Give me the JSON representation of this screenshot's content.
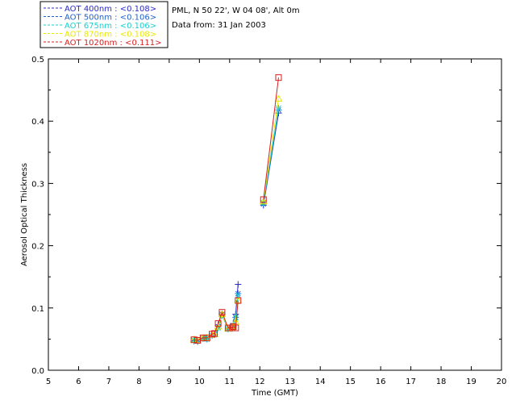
{
  "chart_data": {
    "type": "line",
    "xlabel": "Time (GMT)",
    "ylabel": "Aerosol Optical Thickness",
    "xlim": [
      5,
      20
    ],
    "ylim": [
      0.0,
      0.5
    ],
    "xticks": [
      "5",
      "6",
      "7",
      "8",
      "9",
      "10",
      "11",
      "12",
      "13",
      "14",
      "15",
      "16",
      "17",
      "18",
      "19",
      "20"
    ],
    "yticks": [
      "0.0",
      "0.1",
      "0.2",
      "0.3",
      "0.4",
      "0.5"
    ],
    "info": [
      "PML, N 50 22', W 04 08', Alt 0m",
      "Data from: 31 Jan 2003"
    ],
    "series": [
      {
        "name": "AOT 400nm",
        "mean_label": ": <0.108>",
        "color": "#2a2acb",
        "marker": "plus",
        "x": [
          9.82,
          9.94,
          10.12,
          10.25,
          10.42,
          10.5,
          10.62,
          10.75,
          10.95,
          11.08,
          11.12,
          11.2,
          11.28,
          12.12,
          12.62
        ],
        "y": [
          0.047,
          0.046,
          0.052,
          0.051,
          0.056,
          0.057,
          0.073,
          0.091,
          0.067,
          0.068,
          0.075,
          0.09,
          0.138,
          0.265,
          0.413
        ]
      },
      {
        "name": "AOT 500nm",
        "mean_label": ": <0.106>",
        "color": "#1f61cc",
        "marker": "star",
        "x": [
          9.82,
          9.94,
          10.12,
          10.25,
          10.42,
          10.5,
          10.62,
          10.75,
          10.95,
          11.08,
          11.12,
          11.2,
          11.28,
          12.12,
          12.62
        ],
        "y": [
          0.048,
          0.047,
          0.051,
          0.05,
          0.056,
          0.057,
          0.068,
          0.09,
          0.066,
          0.067,
          0.07,
          0.085,
          0.123,
          0.267,
          0.418
        ]
      },
      {
        "name": "AOT 675nm",
        "mean_label": ": <0.106>",
        "color": "#1acfcf",
        "marker": "asterisk",
        "x": [
          9.82,
          9.94,
          10.12,
          10.25,
          10.42,
          10.5,
          10.62,
          10.75,
          10.95,
          11.08,
          11.12,
          11.2,
          11.28,
          12.12,
          12.62
        ],
        "y": [
          0.048,
          0.047,
          0.051,
          0.05,
          0.056,
          0.057,
          0.068,
          0.088,
          0.066,
          0.067,
          0.07,
          0.084,
          0.12,
          0.269,
          0.421
        ]
      },
      {
        "name": "AOT 870nm",
        "mean_label": ": <0.108>",
        "color": "#e8e800",
        "marker": "triangle",
        "x": [
          9.82,
          9.94,
          10.12,
          10.25,
          10.42,
          10.5,
          10.62,
          10.75,
          10.95,
          11.08,
          11.12,
          11.2,
          11.28,
          12.12,
          12.62
        ],
        "y": [
          0.049,
          0.048,
          0.052,
          0.052,
          0.057,
          0.058,
          0.07,
          0.09,
          0.067,
          0.068,
          0.07,
          0.078,
          0.112,
          0.271,
          0.436
        ]
      },
      {
        "name": "AOT 1020nm",
        "mean_label": ": <0.111>",
        "color": "#d62020",
        "marker": "square",
        "x": [
          9.82,
          9.94,
          10.12,
          10.25,
          10.42,
          10.5,
          10.62,
          10.75,
          10.95,
          11.08,
          11.12,
          11.2,
          11.28,
          12.12,
          12.62
        ],
        "y": [
          0.049,
          0.048,
          0.052,
          0.052,
          0.058,
          0.059,
          0.075,
          0.093,
          0.068,
          0.068,
          0.07,
          0.068,
          0.112,
          0.274,
          0.47
        ]
      }
    ]
  }
}
